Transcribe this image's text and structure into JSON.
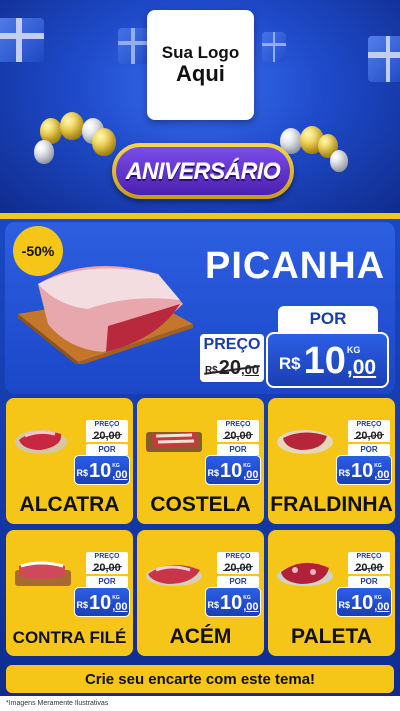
{
  "logo": {
    "line1": "Sua Logo",
    "line2": "Aqui"
  },
  "badge": {
    "text": "ANIVERSÁRIO"
  },
  "hero": {
    "discount": "-50%",
    "product": "PICANHA",
    "preco_label": "PREÇO",
    "old_currency": "R$",
    "old_int": "20",
    "old_dec": ",00",
    "por_label": "POR",
    "new_currency": "R$",
    "new_int": "10",
    "new_dec": ",00",
    "unit": "KG"
  },
  "products": [
    {
      "name": "ALCATRA",
      "preco_label": "PREÇO",
      "old_price": "20,00",
      "por_label": "POR",
      "currency": "R$",
      "int": "10",
      "dec": ",00",
      "unit": "KG"
    },
    {
      "name": "COSTELA",
      "preco_label": "PREÇO",
      "old_price": "20,00",
      "por_label": "POR",
      "currency": "R$",
      "int": "10",
      "dec": ",00",
      "unit": "KG"
    },
    {
      "name": "FRALDINHA",
      "preco_label": "PREÇO",
      "old_price": "20,00",
      "por_label": "POR",
      "currency": "R$",
      "int": "10",
      "dec": ",00",
      "unit": "KG"
    },
    {
      "name": "CONTRA FILÉ",
      "preco_label": "PREÇO",
      "old_price": "20,00",
      "por_label": "POR",
      "currency": "R$",
      "int": "10",
      "dec": ",00",
      "unit": "KG"
    },
    {
      "name": "ACÉM",
      "preco_label": "PREÇO",
      "old_price": "20,00",
      "por_label": "POR",
      "currency": "R$",
      "int": "10",
      "dec": ",00",
      "unit": "KG"
    },
    {
      "name": "PALETA",
      "preco_label": "PREÇO",
      "old_price": "20,00",
      "por_label": "POR",
      "currency": "R$",
      "int": "10",
      "dec": ",00",
      "unit": "KG"
    }
  ],
  "footer": {
    "cta": "Crie seu encarte com este tema!"
  },
  "disclaimer": "*Imagens Meramente Ilustrativas",
  "colors": {
    "blue": "#1b47c8",
    "yellow": "#f5c518",
    "dark_blue": "#0f2c8c"
  }
}
